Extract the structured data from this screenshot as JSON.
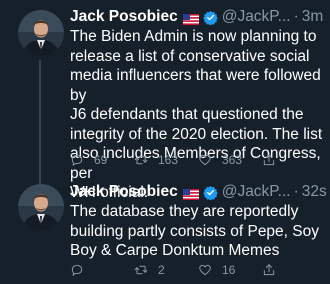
{
  "tweets": [
    {
      "author": "Jack Posobiec",
      "handle": "@JackP...",
      "separator": "·",
      "time": "3m",
      "lines": [
        "The Biden Admin is now planning to",
        "release a list of conservative social",
        "media influencers that were followed by",
        "J6 defendants that questioned the",
        "integrity of the 2020 election. The list",
        "also includes Members of Congress, per",
        "WH official."
      ],
      "reply_count": "69",
      "retweet_count": "163",
      "like_count": "363"
    },
    {
      "author": "Jack Posobiec",
      "handle": "@JackP...",
      "separator": "·",
      "time": "32s",
      "lines": [
        "The database they are reportedly",
        "building partly consists of Pepe, Soy",
        "Boy & Carpe Donktum Memes"
      ],
      "reply_count": "",
      "retweet_count": "2",
      "like_count": "16"
    }
  ],
  "colors": {
    "background": "#15202b",
    "text": "#ffffff",
    "muted": "#8899a6",
    "verified": "#1d9bf0",
    "thread_line": "#38444d"
  },
  "icons": {
    "reply": "comment-bubble-icon",
    "retweet": "retweet-arrows-icon",
    "like": "heart-icon",
    "share": "share-upload-icon",
    "flag": "us-flag-emoji",
    "verified": "verified-badge-icon"
  }
}
